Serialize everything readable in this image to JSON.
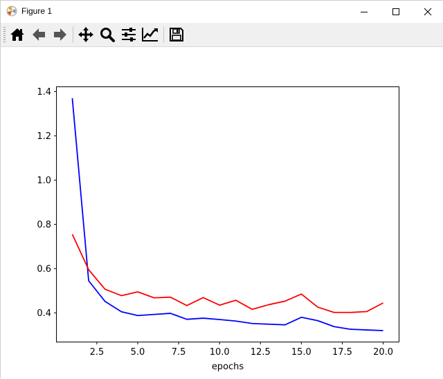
{
  "window": {
    "title": "Figure 1"
  },
  "toolbar": {
    "buttons": [
      "home-icon",
      "back-arrow-icon",
      "forward-arrow-icon",
      "pan-icon",
      "zoom-icon",
      "configure-subplots-icon",
      "edit-axis-icon",
      "save-icon"
    ]
  },
  "chart_data": {
    "type": "line",
    "title": "",
    "xlabel": "epochs",
    "ylabel": "",
    "xlim": [
      0.05,
      20.95
    ],
    "ylim": [
      0.27,
      1.42
    ],
    "xticks": [
      "2.5",
      "5.0",
      "7.5",
      "10.0",
      "12.5",
      "15.0",
      "17.5",
      "20.0"
    ],
    "yticks": [
      "0.4",
      "0.6",
      "0.8",
      "1.0",
      "1.2",
      "1.4"
    ],
    "grid": false,
    "x": [
      1,
      2,
      3,
      4,
      5,
      6,
      7,
      8,
      9,
      10,
      11,
      12,
      13,
      14,
      15,
      16,
      17,
      18,
      19,
      20
    ],
    "series": [
      {
        "color": "#0000ff",
        "values": [
          1.37,
          0.545,
          0.452,
          0.405,
          0.388,
          0.393,
          0.398,
          0.371,
          0.376,
          0.37,
          0.363,
          0.352,
          0.349,
          0.346,
          0.38,
          0.365,
          0.338,
          0.326,
          0.323,
          0.32
        ]
      },
      {
        "color": "#ff0000",
        "values": [
          0.755,
          0.595,
          0.507,
          0.478,
          0.495,
          0.468,
          0.471,
          0.433,
          0.469,
          0.435,
          0.457,
          0.416,
          0.437,
          0.453,
          0.485,
          0.426,
          0.402,
          0.402,
          0.406,
          0.445
        ]
      }
    ]
  }
}
